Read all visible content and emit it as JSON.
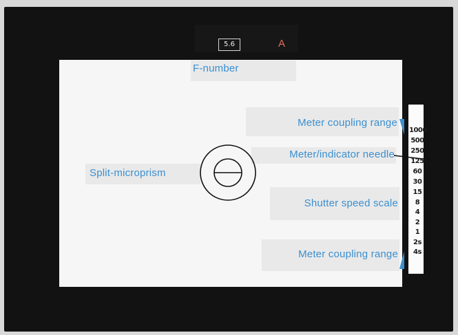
{
  "viewfinder": {
    "aperture_display": "5.6",
    "mode_letter": "A"
  },
  "labels": {
    "f_number": "F-number",
    "meter_coupling_top": "Meter coupling range",
    "meter_needle": "Meter/indicator needle",
    "split_microprism": "Split-microprism",
    "shutter_speed_scale": "Shutter speed scale",
    "meter_coupling_bottom": "Meter coupling range"
  },
  "shutter_scale": [
    "1000",
    "500",
    "250",
    "125",
    "60",
    "30",
    "15",
    "8",
    "4",
    "2",
    "1",
    "2s",
    "4s"
  ],
  "colors": {
    "label_text": "#3a8fd0",
    "mode_letter": "#e26c5a",
    "frame": "#121212"
  }
}
